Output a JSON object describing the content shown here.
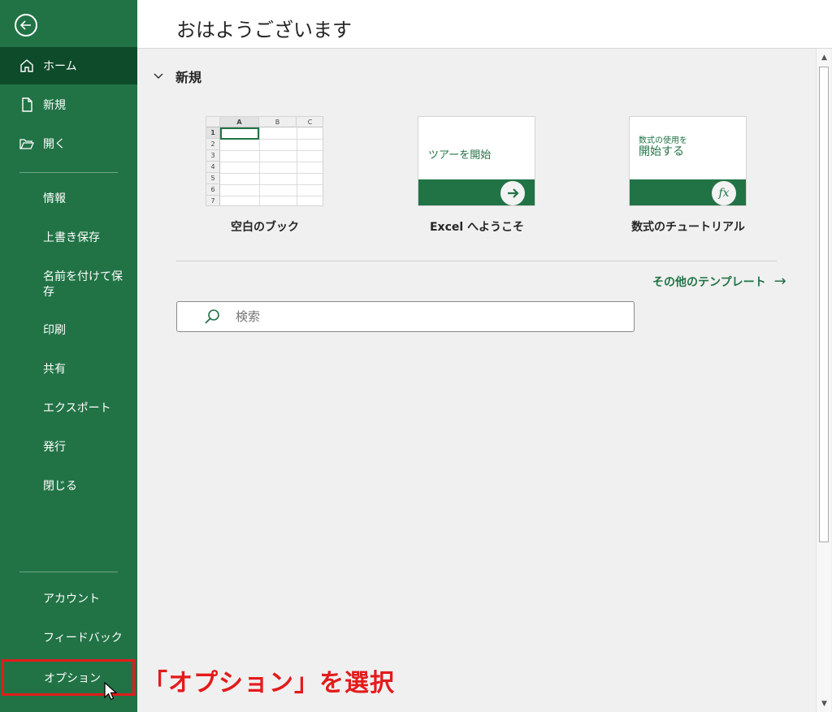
{
  "sidebar": {
    "back_icon": "arrow-left-circle-icon",
    "items": [
      {
        "label": "ホーム",
        "icon": "home-icon"
      },
      {
        "label": "新規",
        "icon": "new-document-icon"
      },
      {
        "label": "開く",
        "icon": "folder-open-icon"
      },
      {
        "label": "情報"
      },
      {
        "label": "上書き保存"
      },
      {
        "label": "名前を付けて保存"
      },
      {
        "label": "印刷"
      },
      {
        "label": "共有"
      },
      {
        "label": "エクスポート"
      },
      {
        "label": "発行"
      },
      {
        "label": "閉じる"
      },
      {
        "label": "アカウント"
      },
      {
        "label": "フィードバック"
      },
      {
        "label": "オプション"
      }
    ],
    "active_index": 0
  },
  "header": {
    "greeting": "おはようございます"
  },
  "new_section": {
    "title": "新規",
    "cards": [
      {
        "label": "空白のブック",
        "columns": [
          "A",
          "B",
          "C"
        ],
        "rows": [
          "1",
          "2",
          "3",
          "4",
          "5",
          "6",
          "7"
        ]
      },
      {
        "label": "Excel へようこそ",
        "thumb_text": "ツアーを開始"
      },
      {
        "label": "数式のチュートリアル",
        "thumb_small": "数式の使用を",
        "thumb_big": "開始する",
        "fx": "fx"
      }
    ],
    "more_templates": "その他のテンプレート",
    "more_arrow": "→"
  },
  "search": {
    "placeholder": "検索"
  },
  "annotation": "「オプション」を選択",
  "colors": {
    "brand": "#217346",
    "brand_dark": "#0e4b2a",
    "highlight": "#e31b1b"
  }
}
